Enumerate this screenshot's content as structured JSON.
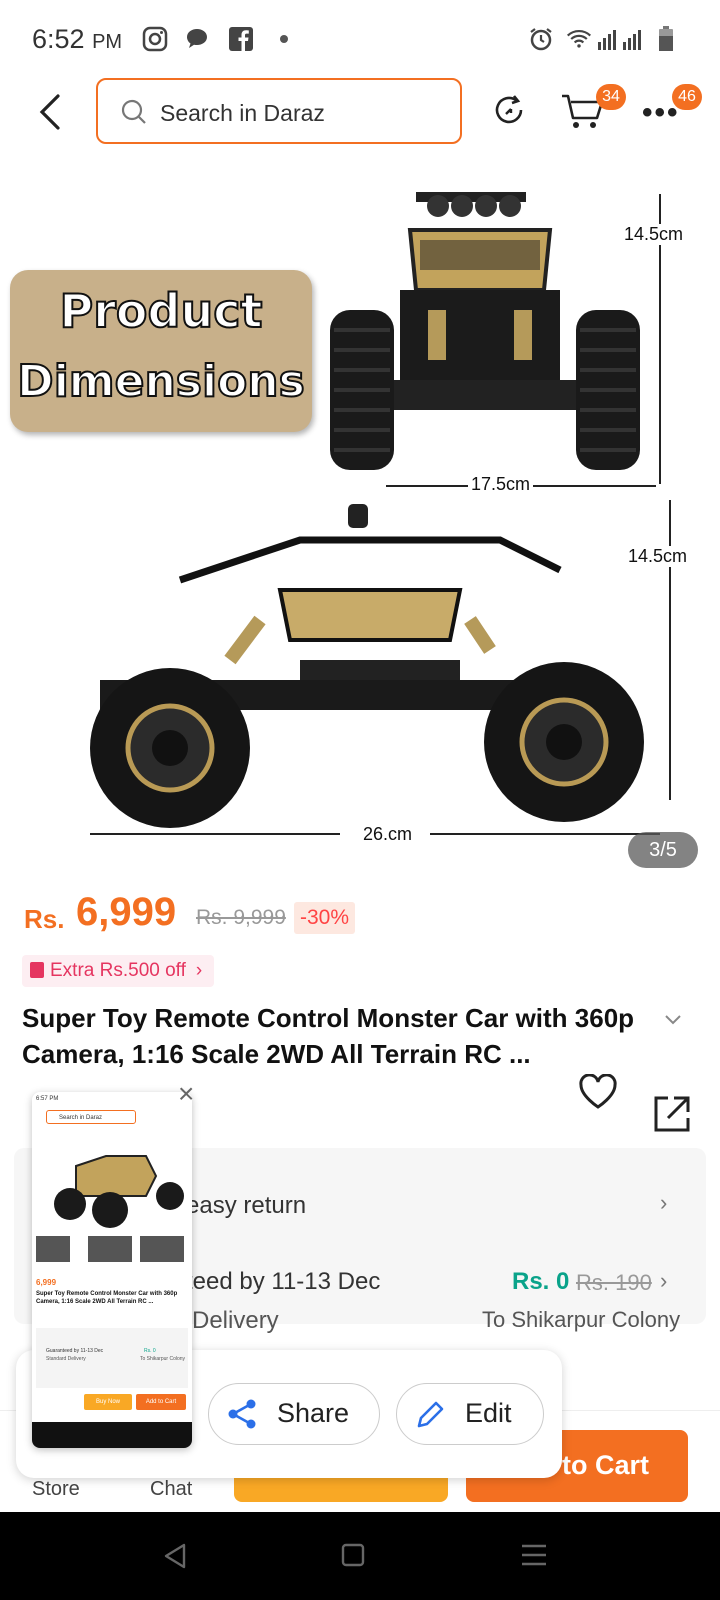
{
  "status_bar": {
    "time": "6:52",
    "ampm": "PM"
  },
  "search": {
    "placeholder": "Search in Daraz"
  },
  "header": {
    "cart_badge": "34",
    "more_badge": "46"
  },
  "gallery": {
    "overlay_title_line1": "Product",
    "overlay_title_line2": "Dimensions",
    "dim_height_top": "14.5cm",
    "dim_width_top": "17.5cm",
    "dim_height_side": "14.5cm",
    "dim_length_side": "26.cm",
    "counter": "3/5"
  },
  "price": {
    "currency": "Rs.",
    "current": "6,999",
    "original": "Rs. 9,999",
    "discount": "-30%",
    "extra_offer": "Extra Rs.500 off"
  },
  "product": {
    "title": "Super Toy Remote Control Monster Car with 360p Camera, 1:16 Scale 2WD All Terrain RC ..."
  },
  "info": {
    "return_text": "easy return",
    "delivery_text": "teed by 11-13 Dec",
    "delivery_type": "Delivery",
    "shipping_fee": "Rs. 0",
    "shipping_old": "Rs. 190",
    "destination": "To Shikarpur Colony"
  },
  "bottom": {
    "store_label": "Store",
    "chat_label": "Chat",
    "cart_label": "to Cart"
  },
  "popup": {
    "share_label": "Share",
    "edit_label": "Edit"
  },
  "thumbnail": {
    "time": "6:57 PM",
    "search": "Search in Daraz",
    "price": "6,999",
    "title": "Super Toy Remote Control Monster Car with 360p Camera, 1:16 Scale 2WD All Terrain RC ...",
    "delivery": "Guaranteed by 11-13 Dec",
    "delivery_type": "Standard Delivery",
    "fee": "Rs. 0",
    "destination": "To Shikarpur Colony",
    "buy_now": "Buy Now",
    "add_to_cart": "Add to Cart"
  },
  "colors": {
    "accent": "#f36f21",
    "buy": "#f9a825",
    "green": "#0aa38a"
  }
}
